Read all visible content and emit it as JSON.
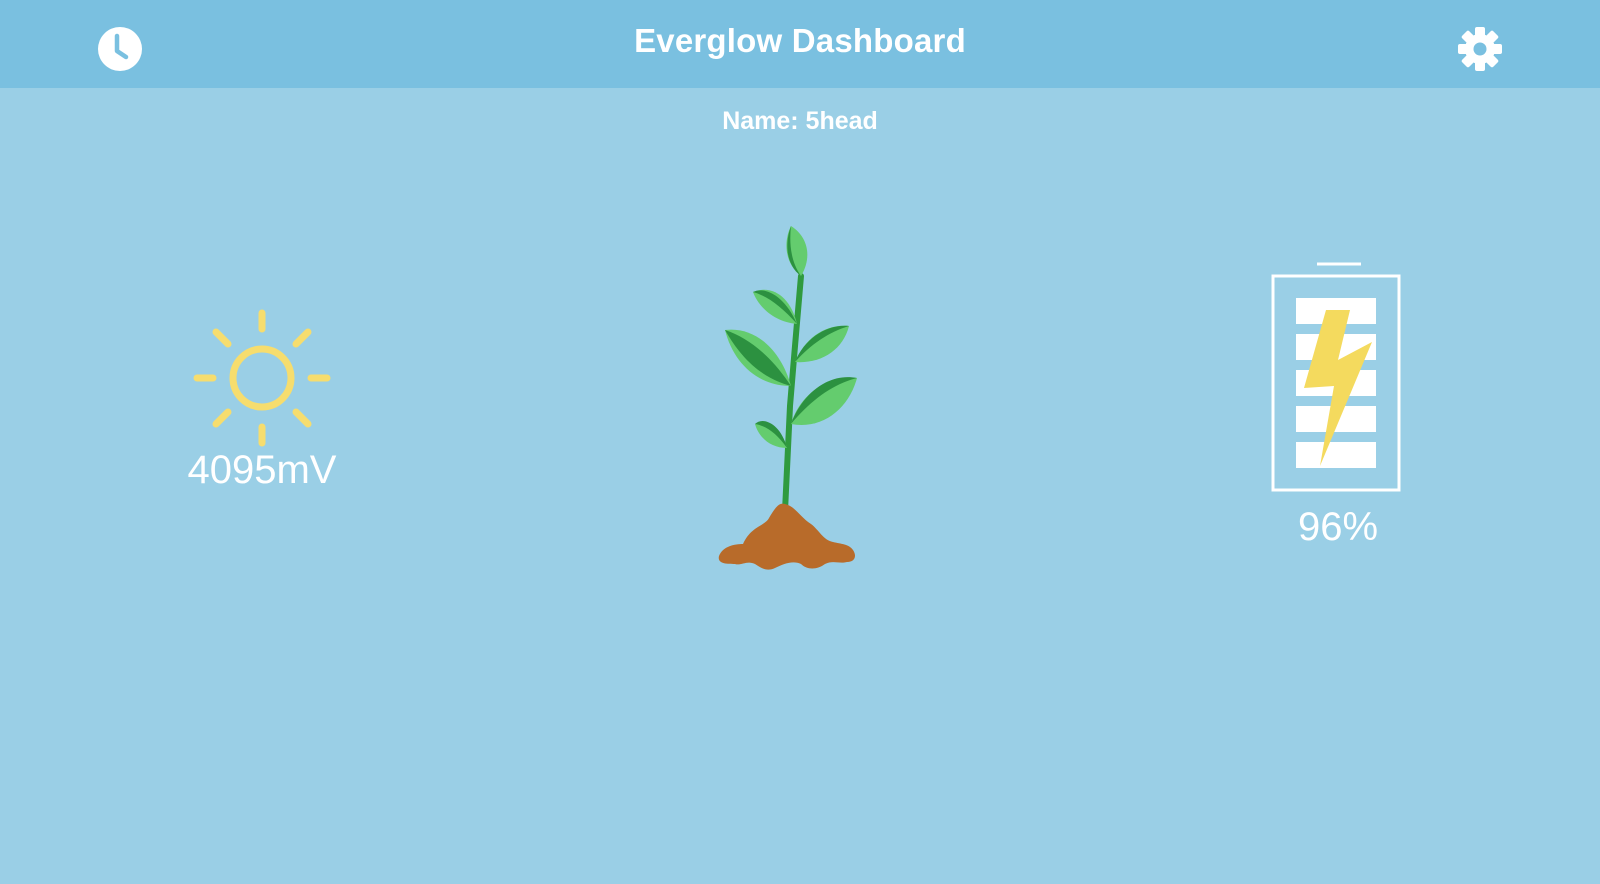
{
  "header": {
    "title": "Everglow Dashboard"
  },
  "device": {
    "name_line": "Name: 5head"
  },
  "solar": {
    "voltage": "4095mV"
  },
  "battery": {
    "percent": "96%",
    "level": 0.96
  },
  "icons": {
    "history": "clock-icon",
    "settings": "gear-icon",
    "solar": "sun-icon",
    "plant": "plant-icon",
    "battery": "battery-charging-icon"
  },
  "colors": {
    "header_bg": "#7ac0e0",
    "page_bg": "#9acfe6",
    "sun": "#f6dd6e",
    "bolt": "#f4da5e",
    "leaf_dark": "#2c9140",
    "leaf_light": "#64cc6e",
    "soil": "#b86b2a"
  }
}
